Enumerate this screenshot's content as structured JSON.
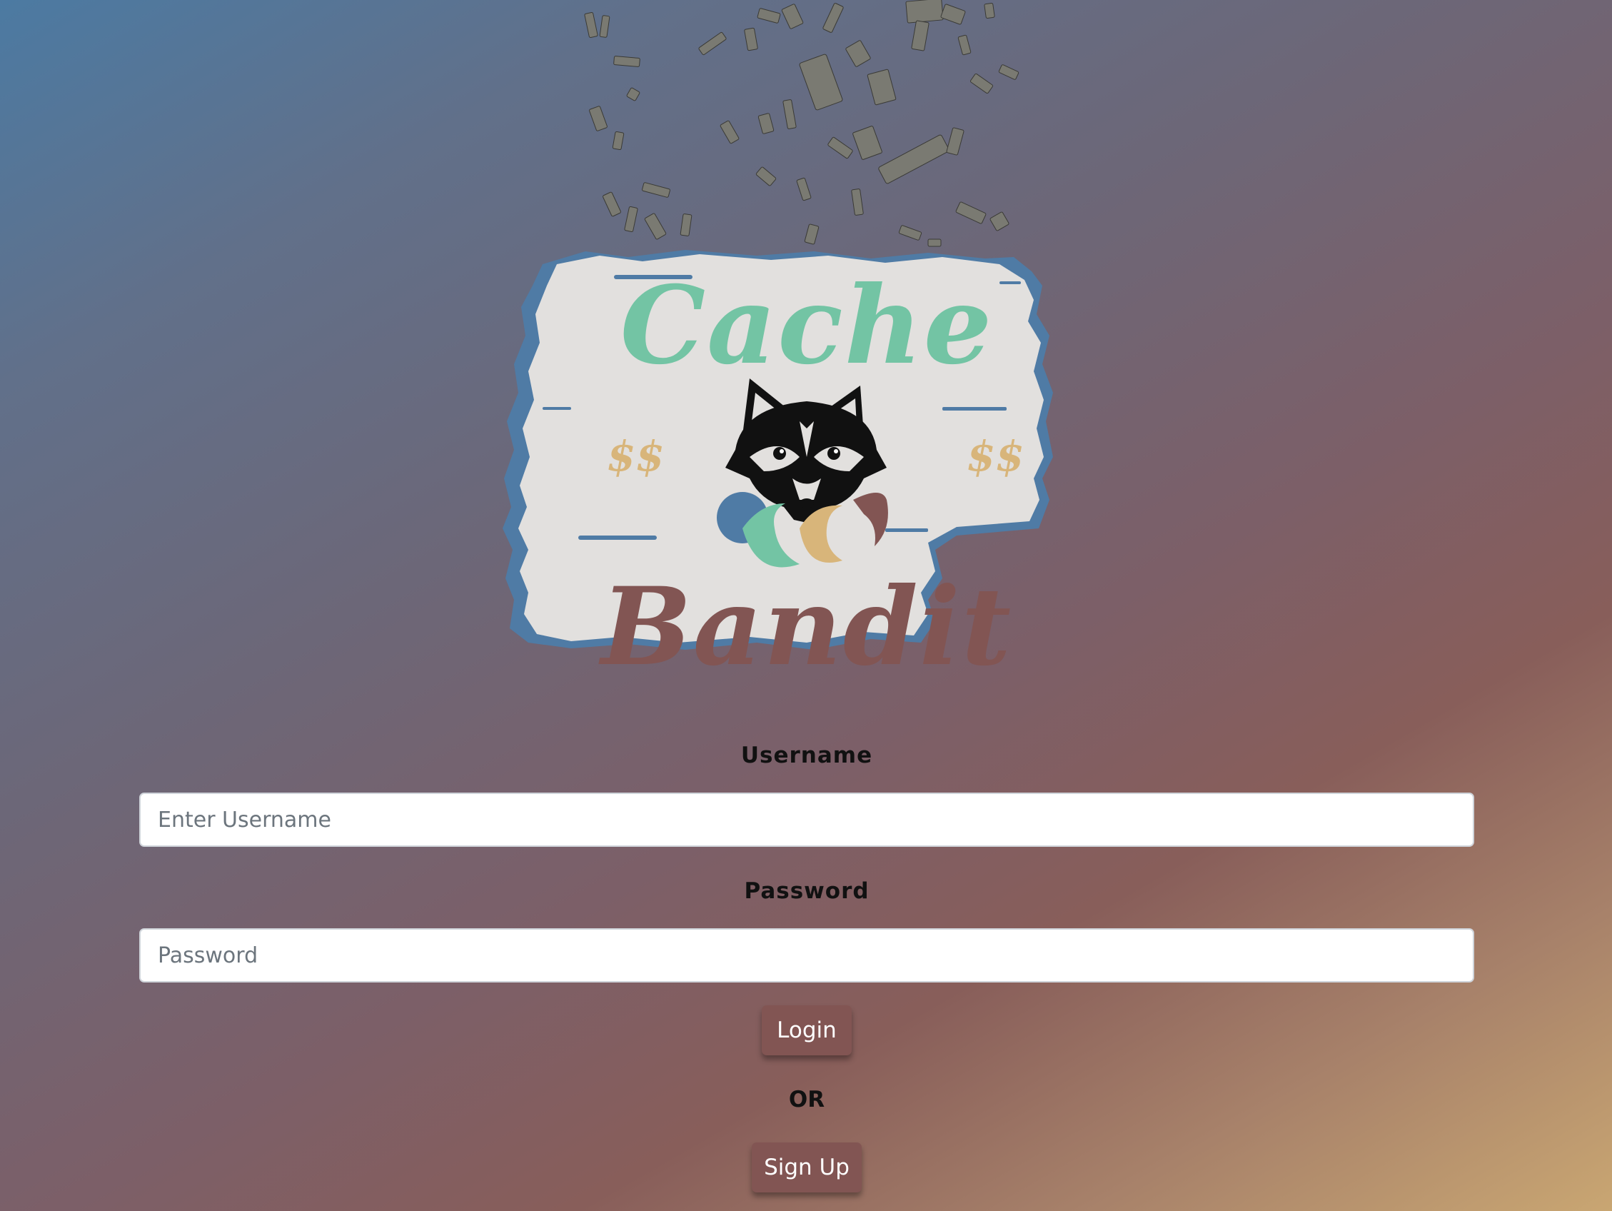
{
  "logo": {
    "line1": "Cache",
    "line2": "Bandit",
    "dollars_left": "$$",
    "dollars_right": "$$",
    "colors": {
      "green": "#73c4a4",
      "brown": "#825553",
      "blue": "#4f7ba5",
      "gold": "#d8b57a",
      "board": "#e2e0de"
    }
  },
  "login_form": {
    "username_label": "Username",
    "username_placeholder": "Enter Username",
    "password_label": "Password",
    "password_placeholder": "Password",
    "login_button": "Login",
    "separator": "OR",
    "signup_button": "Sign Up"
  },
  "theme": {
    "button_color": "#825553",
    "input_border": "#cfd4da"
  }
}
